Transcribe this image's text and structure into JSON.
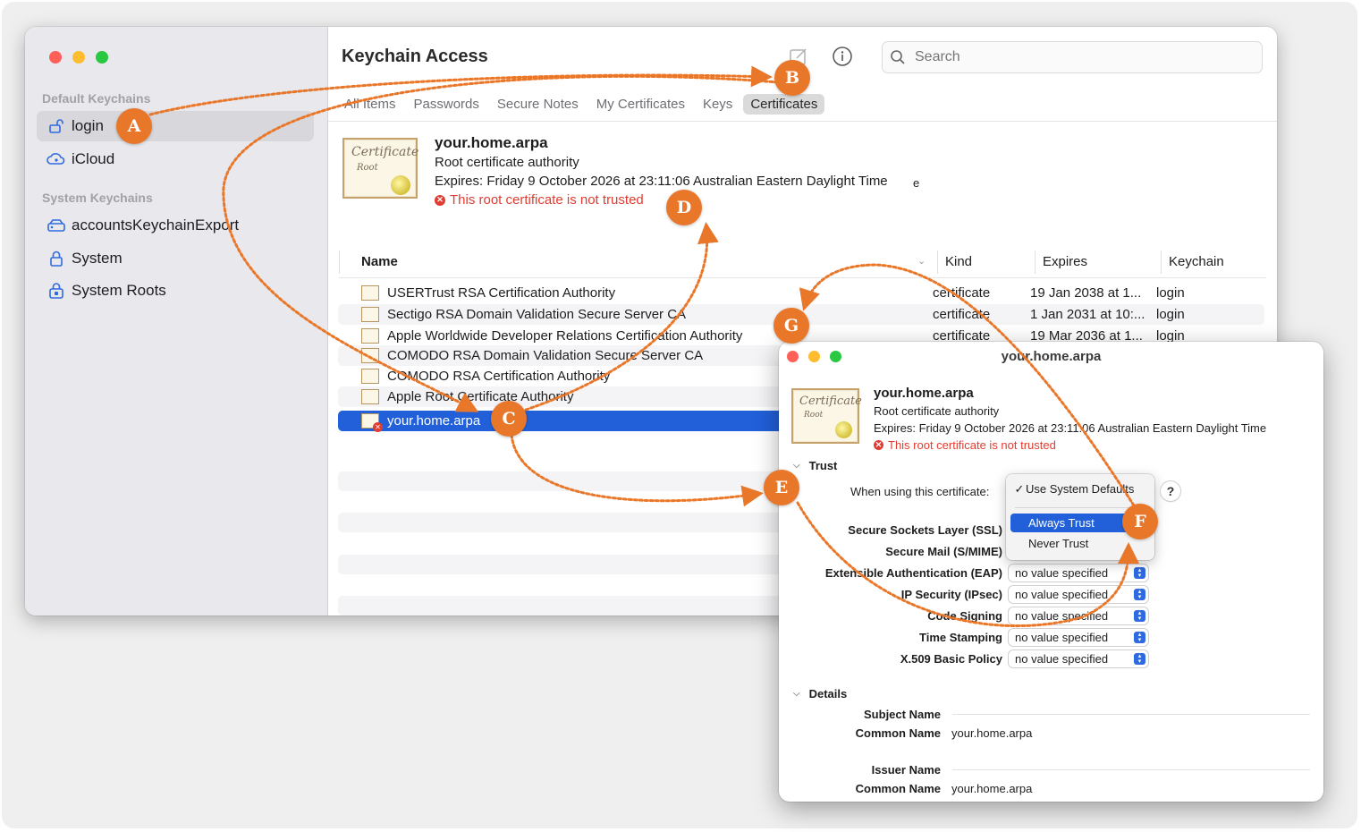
{
  "app": {
    "title": "Keychain Access"
  },
  "sidebar": {
    "default_section": "Default Keychains",
    "system_section": "System Keychains",
    "items": [
      {
        "label": "login",
        "icon": "unlocked-padlock-icon",
        "selected": true
      },
      {
        "label": "iCloud",
        "icon": "icloud-icon"
      },
      {
        "label": "accountsKeychainExport",
        "icon": "drive-icon"
      },
      {
        "label": "System",
        "icon": "padlock-icon"
      },
      {
        "label": "System Roots",
        "icon": "locked-box-icon"
      }
    ]
  },
  "toolbar": {
    "search_placeholder": "Search",
    "compose_icon": "compose-icon",
    "info_icon": "info-icon"
  },
  "tabs": [
    "All Items",
    "Passwords",
    "Secure Notes",
    "My Certificates",
    "Keys",
    "Certificates"
  ],
  "active_tab": "Certificates",
  "detail": {
    "name": "your.home.arpa",
    "type": "Root certificate authority",
    "expires": "Expires: Friday 9 October 2026 at 23:11:06 Australian Eastern Daylight Time",
    "stray": "e",
    "warning": "This root certificate is not trusted",
    "icon_script_1": "Certificate",
    "icon_script_2": "Root"
  },
  "columns": {
    "name": "Name",
    "kind": "Kind",
    "expires": "Expires",
    "keychain": "Keychain"
  },
  "rows": [
    {
      "name": "USERTrust RSA Certification Authority",
      "kind": "certificate",
      "expires": "19 Jan 2038 at 1...",
      "keychain": "login"
    },
    {
      "name": "Sectigo RSA Domain Validation Secure Server CA",
      "kind": "certificate",
      "expires": "1 Jan 2031 at 10:...",
      "keychain": "login"
    },
    {
      "name": "Apple Worldwide Developer Relations Certification Authority",
      "kind": "certificate",
      "expires": "19 Mar 2036 at 1...",
      "keychain": "login"
    },
    {
      "name": "COMODO RSA Domain Validation Secure Server CA",
      "kind": "",
      "expires": "",
      "keychain": ""
    },
    {
      "name": "COMODO RSA Certification Authority",
      "kind": "",
      "expires": "",
      "keychain": ""
    },
    {
      "name": "Apple Root Certificate Authority",
      "kind": "",
      "expires": "",
      "keychain": ""
    },
    {
      "name": "your.home.arpa",
      "kind": "",
      "expires": "",
      "keychain": "",
      "selected": true
    }
  ],
  "overlay": {
    "title": "your.home.arpa",
    "name": "your.home.arpa",
    "type": "Root certificate authority",
    "expires": "Expires: Friday 9 October 2026 at 23:11:06 Australian Eastern Daylight Time",
    "warning": "This root certificate is not trusted",
    "trust_section": "Trust",
    "when_using_label": "When using this certificate:",
    "menu": {
      "checked_option": "Use System Defaults",
      "options": [
        "Always Trust",
        "Never Trust"
      ],
      "highlighted": "Always Trust"
    },
    "help_label": "?",
    "policies": [
      {
        "label": "Secure Sockets Layer (SSL)",
        "value": ""
      },
      {
        "label": "Secure Mail (S/MIME)",
        "value": ""
      },
      {
        "label": "Extensible Authentication (EAP)",
        "value": "no value specified"
      },
      {
        "label": "IP Security (IPsec)",
        "value": "no value specified"
      },
      {
        "label": "Code Signing",
        "value": "no value specified"
      },
      {
        "label": "Time Stamping",
        "value": "no value specified"
      },
      {
        "label": "X.509 Basic Policy",
        "value": "no value specified"
      }
    ],
    "details_section": "Details",
    "subject_name_label": "Subject Name",
    "common_name_label": "Common Name",
    "subject_common_name": "your.home.arpa",
    "issuer_name_label": "Issuer Name",
    "issuer_common_name": "your.home.arpa"
  },
  "annotations": {
    "color": "#e9772a",
    "badges": [
      "A",
      "B",
      "C",
      "D",
      "E",
      "F",
      "G"
    ]
  }
}
